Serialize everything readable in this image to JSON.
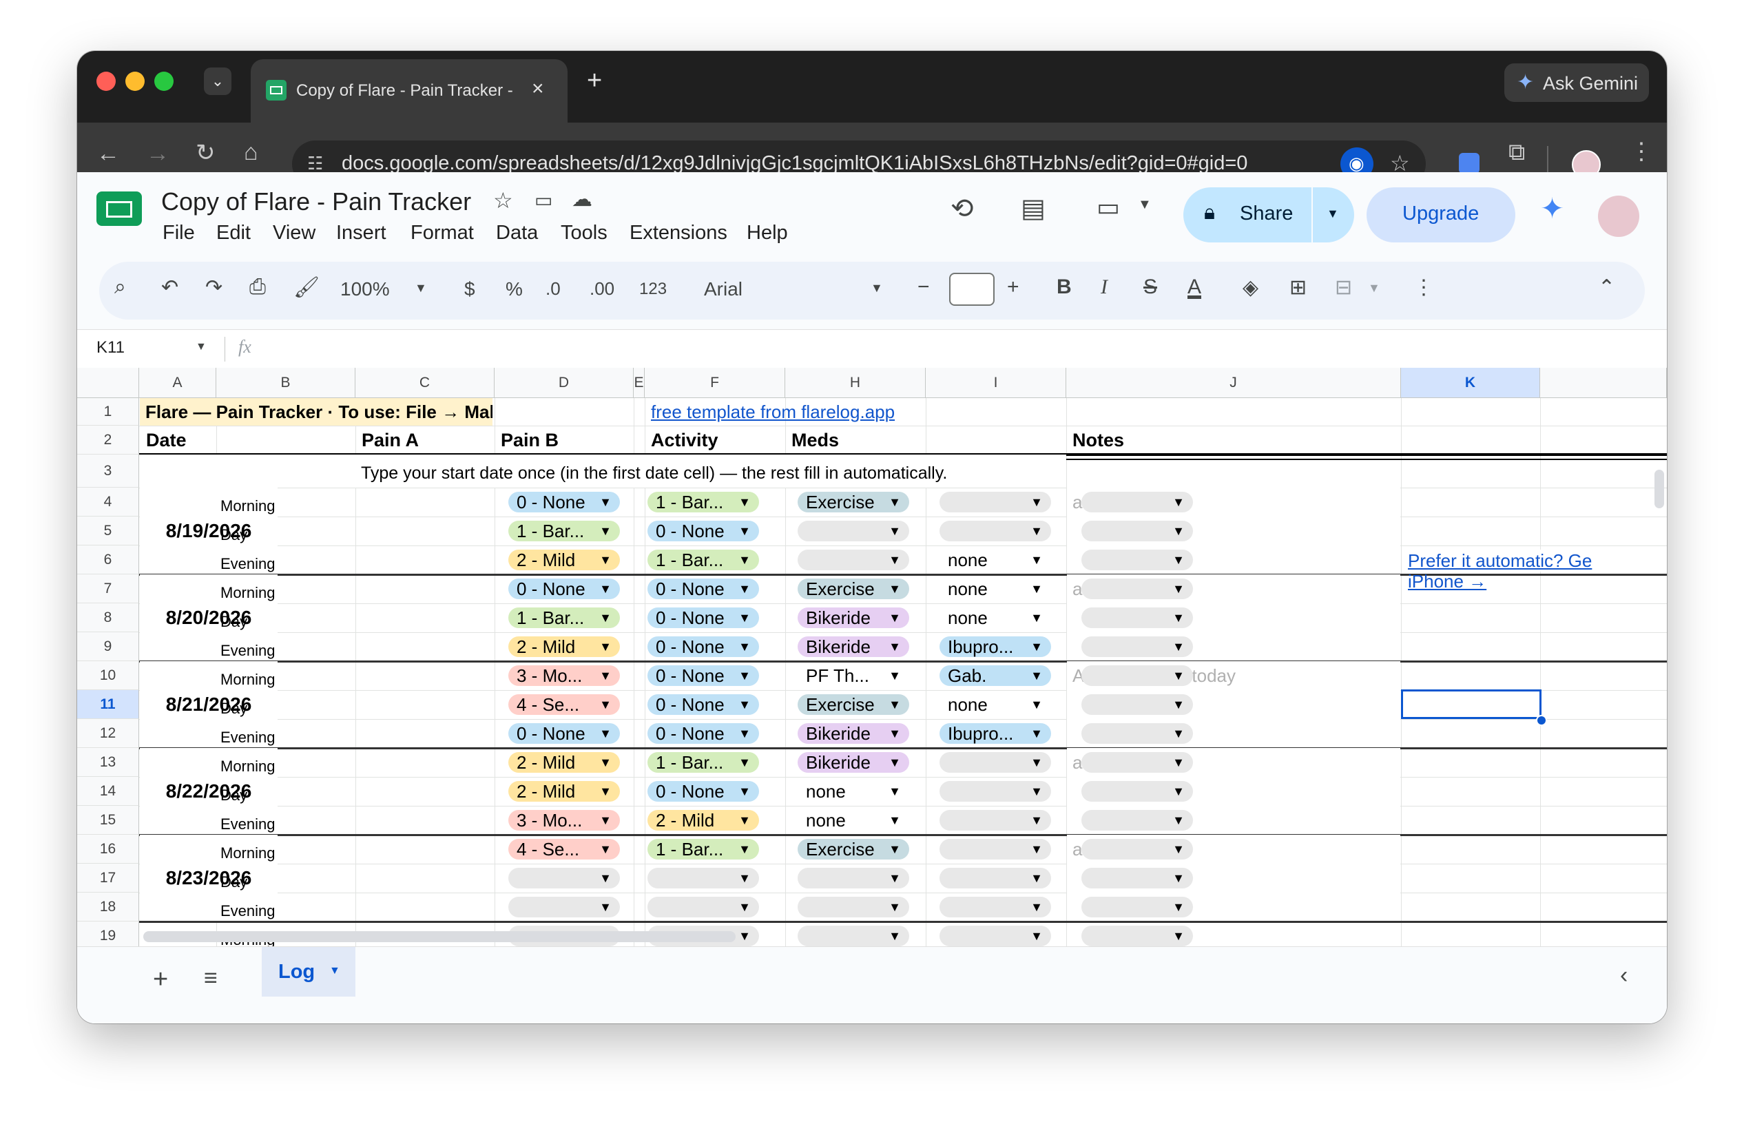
{
  "browser": {
    "tab_title": "Copy of Flare - Pain Tracker - ",
    "new_tab": "+",
    "ask_gemini": "Ask Gemini",
    "url": "docs.google.com/spreadsheets/d/12xg9JdlnivjgGjc1sgcjmltQK1iAbISxsL6h8THzbNs/edit?gid=0#gid=0"
  },
  "doc": {
    "title": "Copy of Flare - Pain Tracker",
    "menus": [
      "File",
      "Edit",
      "View",
      "Insert",
      "Format",
      "Data",
      "Tools",
      "Extensions",
      "Help"
    ],
    "share_label": "Share",
    "upgrade_label": "Upgrade"
  },
  "toolbar": {
    "zoom": "100%",
    "currency": "$",
    "percent": "%",
    "dec_decrease": ".0",
    "dec_increase": ".00",
    "number_format": "123",
    "font": "Arial",
    "font_size": "",
    "minus": "−",
    "plus": "+",
    "bold": "B",
    "italic": "I",
    "strike": "S",
    "text_color": "A"
  },
  "formula_bar": {
    "cell_ref": "K11",
    "fx": "fx",
    "value": ""
  },
  "columns": [
    "A",
    "B",
    "C",
    "D",
    "E",
    "F",
    "H",
    "I",
    "J",
    "K"
  ],
  "row_numbers": [
    "1",
    "2",
    "3",
    "4",
    "5",
    "6",
    "7",
    "8",
    "9",
    "10",
    "11",
    "12",
    "13",
    "14",
    "15",
    "16",
    "17",
    "18",
    "19"
  ],
  "header": {
    "banner": "Flare — Pain Tracker · To use: File → Make a copy",
    "link": "free template from flarelog.app",
    "date": "Date",
    "pain_a": "Pain A",
    "pain_b": "Pain B",
    "activity": "Activity",
    "meds": "Meds",
    "notes": "Notes",
    "instruction": "Type your start date once (in the first date cell) — the rest fill in automatically."
  },
  "side_link": {
    "line1": "Prefer it automatic? Ge",
    "line2": "iPhone →"
  },
  "days": [
    {
      "date": "8/19/2026",
      "note": "add notes here",
      "slots": [
        {
          "time": "Morning",
          "pain_a": "0 - None",
          "pain_b": "1 - Bar...",
          "activity": "Exercise",
          "meds": ""
        },
        {
          "time": "Day",
          "pain_a": "1 - Bar...",
          "pain_b": "0 - None",
          "activity": "",
          "meds": ""
        },
        {
          "time": "Evening",
          "pain_a": "2 - Mild",
          "pain_b": "1 - Bar...",
          "activity": "",
          "meds": "none"
        }
      ]
    },
    {
      "date": "8/20/2026",
      "note": "add notes here",
      "slots": [
        {
          "time": "Morning",
          "pain_a": "0 - None",
          "pain_b": "0 - None",
          "activity": "Exercise",
          "meds": "none"
        },
        {
          "time": "Day",
          "pain_a": "1 - Bar...",
          "pain_b": "0 - None",
          "activity": "Bikeride",
          "meds": "none"
        },
        {
          "time": "Evening",
          "pain_a": "2 - Mild",
          "pain_b": "0 - None",
          "activity": "Bikeride",
          "meds": "Ibupro..."
        }
      ]
    },
    {
      "date": "8/21/2026",
      "note": "A lot of activity today",
      "slots": [
        {
          "time": "Morning",
          "pain_a": "3 - Mo...",
          "pain_b": "0 - None",
          "activity": "PF Th...",
          "meds": "Gab."
        },
        {
          "time": "Day",
          "pain_a": "4 - Se...",
          "pain_b": "0 - None",
          "activity": "Exercise",
          "meds": "none"
        },
        {
          "time": "Evening",
          "pain_a": "0 - None",
          "pain_b": "0 - None",
          "activity": "Bikeride",
          "meds": "Ibupro..."
        }
      ]
    },
    {
      "date": "8/22/2026",
      "note": "add notes here",
      "slots": [
        {
          "time": "Morning",
          "pain_a": "2 - Mild",
          "pain_b": "1 - Bar...",
          "activity": "Bikeride",
          "meds": ""
        },
        {
          "time": "Day",
          "pain_a": "2 - Mild",
          "pain_b": "0 - None",
          "activity": "none",
          "meds": ""
        },
        {
          "time": "Evening",
          "pain_a": "3 - Mo...",
          "pain_b": "2 - Mild",
          "activity": "none",
          "meds": ""
        }
      ]
    },
    {
      "date": "8/23/2026",
      "note": "add notes here",
      "slots": [
        {
          "time": "Morning",
          "pain_a": "4 - Se...",
          "pain_b": "1 - Bar...",
          "activity": "Exercise",
          "meds": ""
        },
        {
          "time": "Day",
          "pain_a": "",
          "pain_b": "",
          "activity": "",
          "meds": ""
        },
        {
          "time": "Evening",
          "pain_a": "",
          "pain_b": "",
          "activity": "",
          "meds": ""
        }
      ]
    }
  ],
  "row19_time": "Morning",
  "sheet_tab": "Log",
  "colors": {
    "none": "#bfe1f6",
    "bar": "#d4edbc",
    "mild": "#ffe5a0",
    "mod": "#ffcfc9",
    "sev": "#ffcfc9",
    "exercise": "#c6dbe1",
    "bikeride": "#e6cff2",
    "med": "#bfe1f6",
    "banner": "#fff2cc",
    "link": "#1155cc",
    "select": "#0b57d0"
  }
}
